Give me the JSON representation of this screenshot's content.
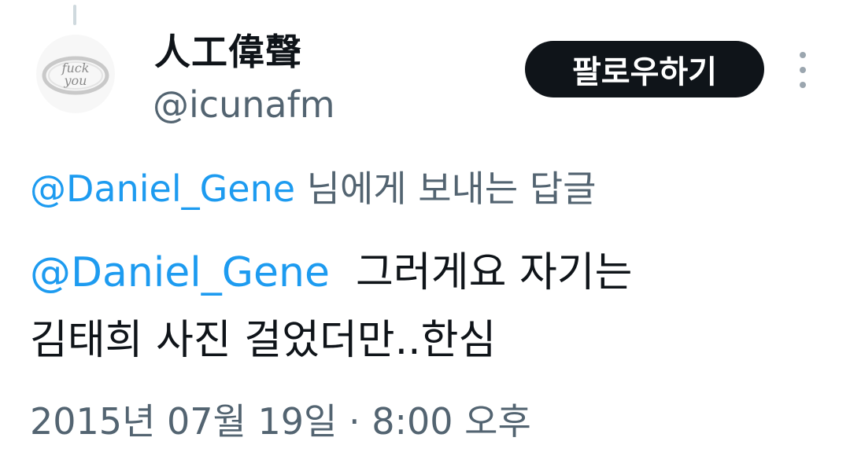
{
  "author": {
    "display_name": "人工偉聲",
    "handle": "@icunafm",
    "avatar_icon": "ring-avatar-icon",
    "avatar_text": "fuck you"
  },
  "actions": {
    "follow_label": "팔로우하기",
    "more_icon": "more-vertical-icon"
  },
  "reply_context": {
    "mention": "@Daniel_Gene",
    "suffix": " 님에게 보내는 답글"
  },
  "tweet": {
    "mention": "@Daniel_Gene",
    "line1_text": "  그러게요 자기는",
    "line2_text": "김태희 사진 걸었더만..한심"
  },
  "timestamp": "2015년 07월 19일 · 8:00 오후",
  "colors": {
    "link": "#1d9bf0",
    "secondary_text": "#536471",
    "primary_text": "#0f1419",
    "button_bg": "#0f1419"
  }
}
